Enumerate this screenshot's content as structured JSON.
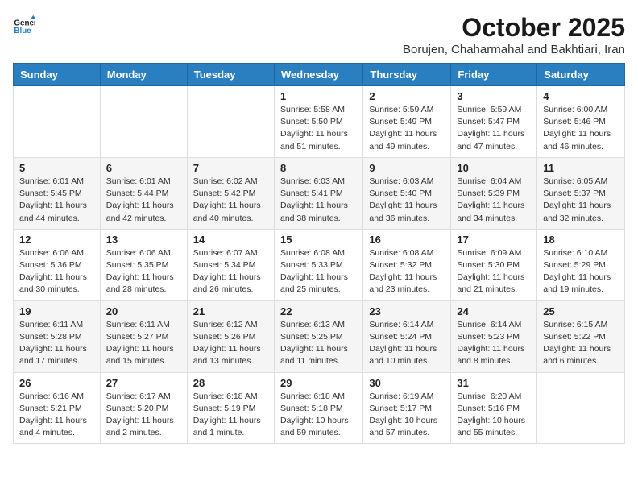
{
  "logo": {
    "line1": "General",
    "line2": "Blue"
  },
  "title": "October 2025",
  "location": "Borujen, Chaharmahal and Bakhtiari, Iran",
  "headers": [
    "Sunday",
    "Monday",
    "Tuesday",
    "Wednesday",
    "Thursday",
    "Friday",
    "Saturday"
  ],
  "weeks": [
    [
      {
        "day": "",
        "info": ""
      },
      {
        "day": "",
        "info": ""
      },
      {
        "day": "",
        "info": ""
      },
      {
        "day": "1",
        "info": "Sunrise: 5:58 AM\nSunset: 5:50 PM\nDaylight: 11 hours\nand 51 minutes."
      },
      {
        "day": "2",
        "info": "Sunrise: 5:59 AM\nSunset: 5:49 PM\nDaylight: 11 hours\nand 49 minutes."
      },
      {
        "day": "3",
        "info": "Sunrise: 5:59 AM\nSunset: 5:47 PM\nDaylight: 11 hours\nand 47 minutes."
      },
      {
        "day": "4",
        "info": "Sunrise: 6:00 AM\nSunset: 5:46 PM\nDaylight: 11 hours\nand 46 minutes."
      }
    ],
    [
      {
        "day": "5",
        "info": "Sunrise: 6:01 AM\nSunset: 5:45 PM\nDaylight: 11 hours\nand 44 minutes."
      },
      {
        "day": "6",
        "info": "Sunrise: 6:01 AM\nSunset: 5:44 PM\nDaylight: 11 hours\nand 42 minutes."
      },
      {
        "day": "7",
        "info": "Sunrise: 6:02 AM\nSunset: 5:42 PM\nDaylight: 11 hours\nand 40 minutes."
      },
      {
        "day": "8",
        "info": "Sunrise: 6:03 AM\nSunset: 5:41 PM\nDaylight: 11 hours\nand 38 minutes."
      },
      {
        "day": "9",
        "info": "Sunrise: 6:03 AM\nSunset: 5:40 PM\nDaylight: 11 hours\nand 36 minutes."
      },
      {
        "day": "10",
        "info": "Sunrise: 6:04 AM\nSunset: 5:39 PM\nDaylight: 11 hours\nand 34 minutes."
      },
      {
        "day": "11",
        "info": "Sunrise: 6:05 AM\nSunset: 5:37 PM\nDaylight: 11 hours\nand 32 minutes."
      }
    ],
    [
      {
        "day": "12",
        "info": "Sunrise: 6:06 AM\nSunset: 5:36 PM\nDaylight: 11 hours\nand 30 minutes."
      },
      {
        "day": "13",
        "info": "Sunrise: 6:06 AM\nSunset: 5:35 PM\nDaylight: 11 hours\nand 28 minutes."
      },
      {
        "day": "14",
        "info": "Sunrise: 6:07 AM\nSunset: 5:34 PM\nDaylight: 11 hours\nand 26 minutes."
      },
      {
        "day": "15",
        "info": "Sunrise: 6:08 AM\nSunset: 5:33 PM\nDaylight: 11 hours\nand 25 minutes."
      },
      {
        "day": "16",
        "info": "Sunrise: 6:08 AM\nSunset: 5:32 PM\nDaylight: 11 hours\nand 23 minutes."
      },
      {
        "day": "17",
        "info": "Sunrise: 6:09 AM\nSunset: 5:30 PM\nDaylight: 11 hours\nand 21 minutes."
      },
      {
        "day": "18",
        "info": "Sunrise: 6:10 AM\nSunset: 5:29 PM\nDaylight: 11 hours\nand 19 minutes."
      }
    ],
    [
      {
        "day": "19",
        "info": "Sunrise: 6:11 AM\nSunset: 5:28 PM\nDaylight: 11 hours\nand 17 minutes."
      },
      {
        "day": "20",
        "info": "Sunrise: 6:11 AM\nSunset: 5:27 PM\nDaylight: 11 hours\nand 15 minutes."
      },
      {
        "day": "21",
        "info": "Sunrise: 6:12 AM\nSunset: 5:26 PM\nDaylight: 11 hours\nand 13 minutes."
      },
      {
        "day": "22",
        "info": "Sunrise: 6:13 AM\nSunset: 5:25 PM\nDaylight: 11 hours\nand 11 minutes."
      },
      {
        "day": "23",
        "info": "Sunrise: 6:14 AM\nSunset: 5:24 PM\nDaylight: 11 hours\nand 10 minutes."
      },
      {
        "day": "24",
        "info": "Sunrise: 6:14 AM\nSunset: 5:23 PM\nDaylight: 11 hours\nand 8 minutes."
      },
      {
        "day": "25",
        "info": "Sunrise: 6:15 AM\nSunset: 5:22 PM\nDaylight: 11 hours\nand 6 minutes."
      }
    ],
    [
      {
        "day": "26",
        "info": "Sunrise: 6:16 AM\nSunset: 5:21 PM\nDaylight: 11 hours\nand 4 minutes."
      },
      {
        "day": "27",
        "info": "Sunrise: 6:17 AM\nSunset: 5:20 PM\nDaylight: 11 hours\nand 2 minutes."
      },
      {
        "day": "28",
        "info": "Sunrise: 6:18 AM\nSunset: 5:19 PM\nDaylight: 11 hours\nand 1 minute."
      },
      {
        "day": "29",
        "info": "Sunrise: 6:18 AM\nSunset: 5:18 PM\nDaylight: 10 hours\nand 59 minutes."
      },
      {
        "day": "30",
        "info": "Sunrise: 6:19 AM\nSunset: 5:17 PM\nDaylight: 10 hours\nand 57 minutes."
      },
      {
        "day": "31",
        "info": "Sunrise: 6:20 AM\nSunset: 5:16 PM\nDaylight: 10 hours\nand 55 minutes."
      },
      {
        "day": "",
        "info": ""
      }
    ]
  ]
}
